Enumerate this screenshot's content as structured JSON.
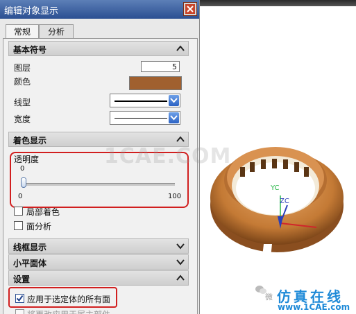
{
  "dialog": {
    "title": "编辑对象显示",
    "tabs": [
      {
        "label": "常规",
        "active": true
      },
      {
        "label": "分析",
        "active": false
      }
    ],
    "sections": {
      "basic_symbol": {
        "title": "基本符号",
        "expanded": true
      },
      "shaded_display": {
        "title": "着色显示",
        "expanded": true
      },
      "wireframe_display": {
        "title": "线框显示",
        "expanded": false
      },
      "facet": {
        "title": "小平面体",
        "expanded": false
      },
      "settings": {
        "title": "设置",
        "expanded": true
      }
    },
    "layer": {
      "label": "图层",
      "value": "5"
    },
    "color": {
      "label": "颜色",
      "swatch": "#a0602f"
    },
    "line_type": {
      "label": "线型"
    },
    "width": {
      "label": "宽度"
    },
    "transparency": {
      "label": "透明度",
      "current": "0",
      "min": "0",
      "max": "100",
      "value_fraction": 0
    },
    "local_shading": {
      "label": "局部着色",
      "checked": false
    },
    "face_analysis": {
      "label": "面分析",
      "checked": false
    },
    "apply_all_faces": {
      "label": "应用于选定体的所有面",
      "checked": true
    },
    "partial_hidden": {
      "label": "将更改应用于属主部件"
    }
  },
  "viewport": {
    "axes": {
      "yc": "YC",
      "zc": "ZC"
    },
    "watermark": {
      "center": "1CAE.COM",
      "brand_cn": "仿真在线",
      "brand_url": "www.1CAE.com",
      "wechat_text": "微"
    }
  },
  "colors": {
    "title_bar": "#2b4f92",
    "highlight": "#d11f1f",
    "part": "#c8823f",
    "brand": "#1f8ad8"
  }
}
